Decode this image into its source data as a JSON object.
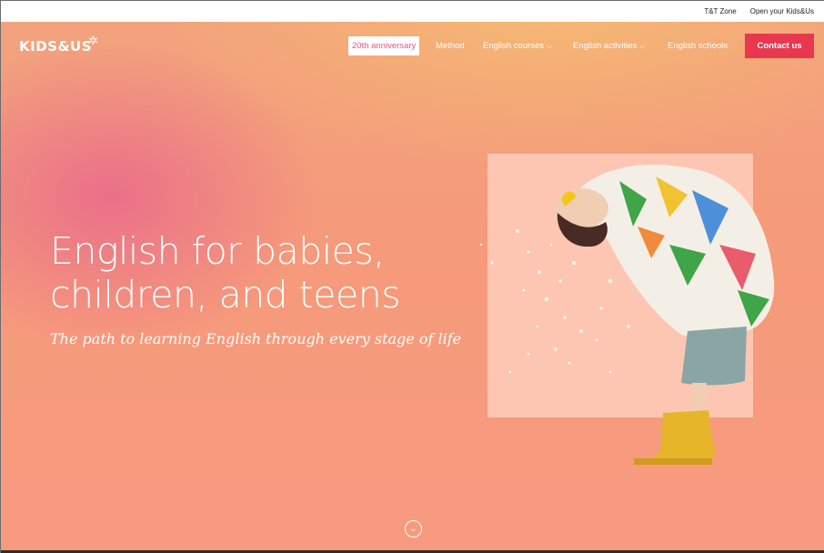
{
  "utility_bar": {
    "links": [
      "T&T Zone",
      "Open your Kids&Us"
    ]
  },
  "nav": {
    "logo": "KIDS&US",
    "anniversary": "20th anniversary",
    "method": "Method",
    "english_courses": "English courses",
    "english_activities": "English activities",
    "english_schools": "English schools",
    "contact": "Contact us"
  },
  "hero": {
    "headline_line1": "English for babies,",
    "headline_line2": "children, and teens",
    "tagline": "The path to learning English through every stage of life"
  },
  "colors": {
    "accent": "#e8384f",
    "anniversary_text": "#e8587a",
    "hero_pink": "#e8688c",
    "hero_peach": "#f89a80",
    "hero_orange": "#f6b872"
  },
  "icons": {
    "logo_star": "asterisk-flower-icon",
    "dropdown": "chevron-down-icon",
    "scroll": "circle-chevron-down-icon"
  }
}
